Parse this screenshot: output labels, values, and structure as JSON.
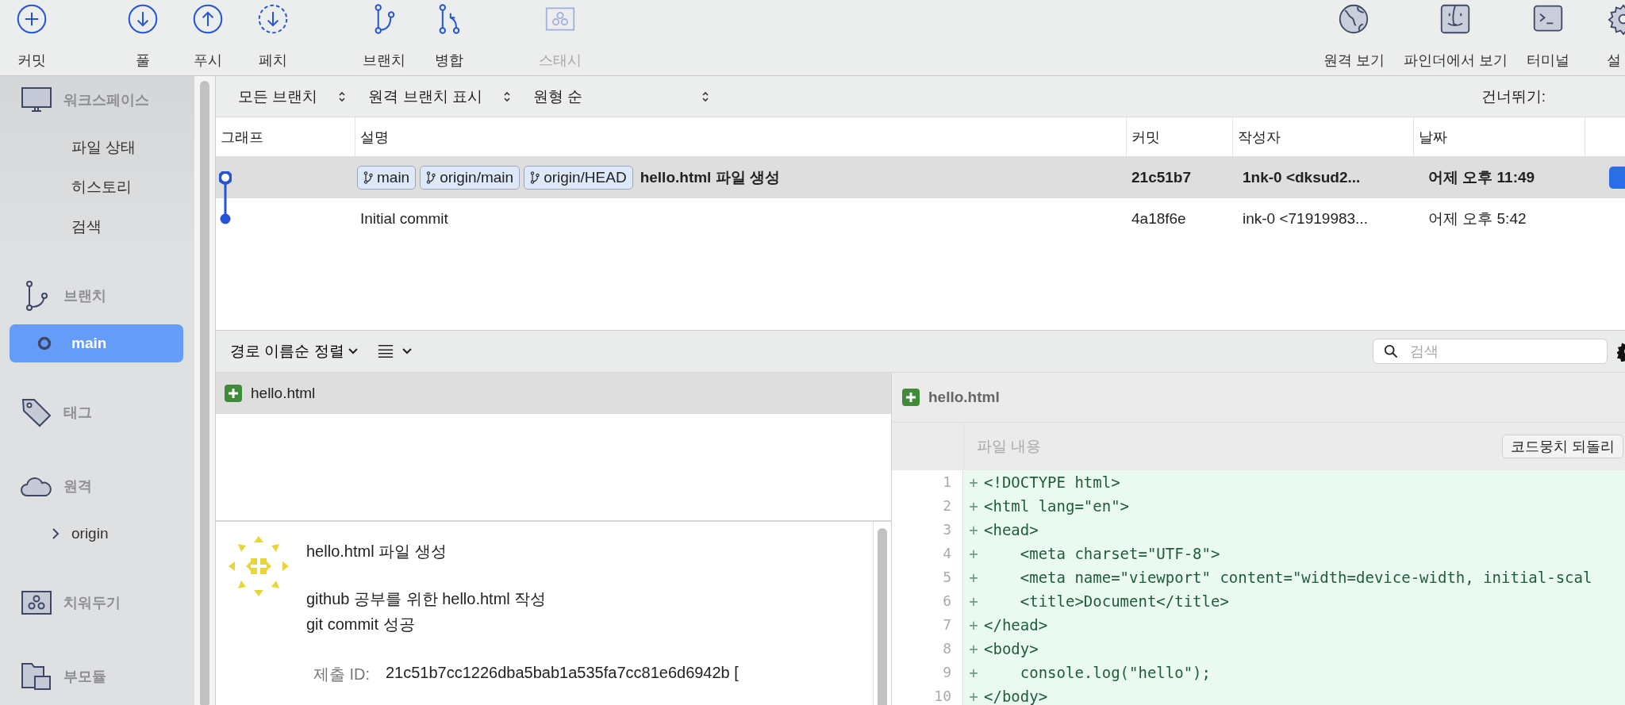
{
  "toolbar": {
    "groups": [
      [
        {
          "label": "커밋",
          "kind": "commit",
          "disabled": false
        }
      ],
      [
        {
          "label": "풀",
          "kind": "pull",
          "disabled": false
        },
        {
          "label": "푸시",
          "kind": "push",
          "disabled": false
        },
        {
          "label": "페치",
          "kind": "fetch",
          "disabled": false
        }
      ],
      [
        {
          "label": "브랜치",
          "kind": "branch",
          "disabled": false
        },
        {
          "label": "병합",
          "kind": "merge",
          "disabled": false
        }
      ],
      [
        {
          "label": "스태시",
          "kind": "stash",
          "disabled": true
        }
      ]
    ],
    "right": [
      {
        "label": "원격 보기",
        "kind": "globe",
        "disabled": false
      },
      {
        "label": "파인더에서 보기",
        "kind": "finder",
        "disabled": false
      },
      {
        "label": "터미널",
        "kind": "terminal",
        "disabled": false
      },
      {
        "label": "설",
        "kind": "settings",
        "disabled": false
      }
    ]
  },
  "sidebar": {
    "sections": [
      {
        "label": "워크스페이스",
        "kind": "workspace",
        "items": [
          {
            "label": "파일 상태",
            "selected": false
          },
          {
            "label": "히스토리",
            "selected": false
          },
          {
            "label": "검색",
            "selected": false
          }
        ]
      },
      {
        "label": "브랜치",
        "kind": "branch",
        "items": [
          {
            "label": "main",
            "selected": true
          }
        ]
      },
      {
        "label": "태그",
        "kind": "tag"
      },
      {
        "label": "원격",
        "kind": "remote",
        "items": [
          {
            "label": "origin",
            "selected": false,
            "expanded": false
          }
        ]
      },
      {
        "label": "치워두기",
        "kind": "stash"
      },
      {
        "label": "부모듈",
        "kind": "submodule"
      }
    ]
  },
  "filters": [
    {
      "label": "모든 브랜치"
    },
    {
      "label": "원격 브랜치 표시"
    },
    {
      "label": "원형 순"
    }
  ],
  "jump_label": "건너뛰기:",
  "table": {
    "columns": [
      "그래프",
      "설명",
      "커밋",
      "작성자",
      "날짜"
    ],
    "rows": [
      {
        "selected": true,
        "head": true,
        "refs": [
          "main",
          "origin/main",
          "origin/HEAD"
        ],
        "description": "hello.html 파일 생성",
        "commit": "21c51b7",
        "author": "1nk-0 <dksud2...",
        "date": "어제 오후 11:49"
      },
      {
        "selected": false,
        "head": false,
        "description": "Initial commit",
        "commit": "4a18f6e",
        "author": "ink-0 <71919983...",
        "date": "어제 오후 5:42"
      }
    ]
  },
  "file_bar": {
    "sort_label": "경로 이름순 정렬",
    "search": {
      "placeholder": "검색"
    }
  },
  "files": [
    {
      "name": "hello.html",
      "kind": "added",
      "selected": true
    }
  ],
  "commit_detail": {
    "title": "hello.html 파일 생성",
    "body": [
      "github 공부를 위한 hello.html 작성",
      "git commit 성공"
    ],
    "fields": [
      {
        "label": "제출 ID:",
        "value": "21c51b7cc1226dba5bab1a535fa7cc81e6d6942b ["
      }
    ]
  },
  "diff": {
    "file": "hello.html",
    "kind": "added",
    "hunk_title": "파일 내용",
    "hunk_button": "코드뭉치 되돌리",
    "lines": [
      {
        "number": "1",
        "sign": "+",
        "text": "<!DOCTYPE html>"
      },
      {
        "number": "2",
        "sign": "+",
        "text": "<html lang=\"en\">"
      },
      {
        "number": "3",
        "sign": "+",
        "text": "<head>"
      },
      {
        "number": "4",
        "sign": "+",
        "text": "    <meta charset=\"UTF-8\">"
      },
      {
        "number": "5",
        "sign": "+",
        "text": "    <meta name=\"viewport\" content=\"width=device-width, initial-scal"
      },
      {
        "number": "6",
        "sign": "+",
        "text": "    <title>Document</title>"
      },
      {
        "number": "7",
        "sign": "+",
        "text": "</head>"
      },
      {
        "number": "8",
        "sign": "+",
        "text": "<body>"
      },
      {
        "number": "9",
        "sign": "+",
        "text": "    console.log(\"hello\");"
      },
      {
        "number": "10",
        "sign": "+",
        "text": "</body>"
      }
    ]
  }
}
